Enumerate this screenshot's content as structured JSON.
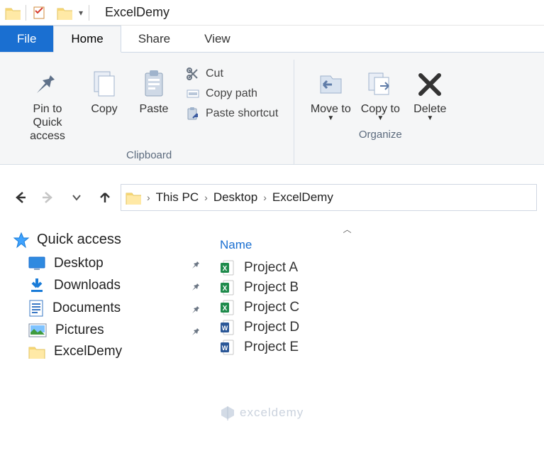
{
  "titlebar": {
    "title": "ExcelDemy"
  },
  "tabs": {
    "file": "File",
    "home": "Home",
    "share": "Share",
    "view": "View"
  },
  "ribbon": {
    "pin": "Pin to Quick access",
    "copy": "Copy",
    "paste": "Paste",
    "cut": "Cut",
    "copypath": "Copy path",
    "pasteshortcut": "Paste shortcut",
    "clipboard_label": "Clipboard",
    "moveto": "Move to",
    "copyto": "Copy to",
    "delete": "Delete",
    "organize_label": "Organize"
  },
  "breadcrumb": {
    "seg0": "This PC",
    "seg1": "Desktop",
    "seg2": "ExcelDemy"
  },
  "nav": {
    "quick_access": "Quick access",
    "items": [
      {
        "label": "Desktop",
        "pinned": true
      },
      {
        "label": "Downloads",
        "pinned": true
      },
      {
        "label": "Documents",
        "pinned": true
      },
      {
        "label": "Pictures",
        "pinned": true
      },
      {
        "label": "ExcelDemy",
        "pinned": false
      }
    ]
  },
  "columns": {
    "name": "Name"
  },
  "files": [
    {
      "name": "Project A",
      "type": "excel"
    },
    {
      "name": "Project B",
      "type": "excel"
    },
    {
      "name": "Project C",
      "type": "excel"
    },
    {
      "name": "Project D",
      "type": "word"
    },
    {
      "name": "Project E",
      "type": "word"
    }
  ],
  "watermark": "exceldemy"
}
